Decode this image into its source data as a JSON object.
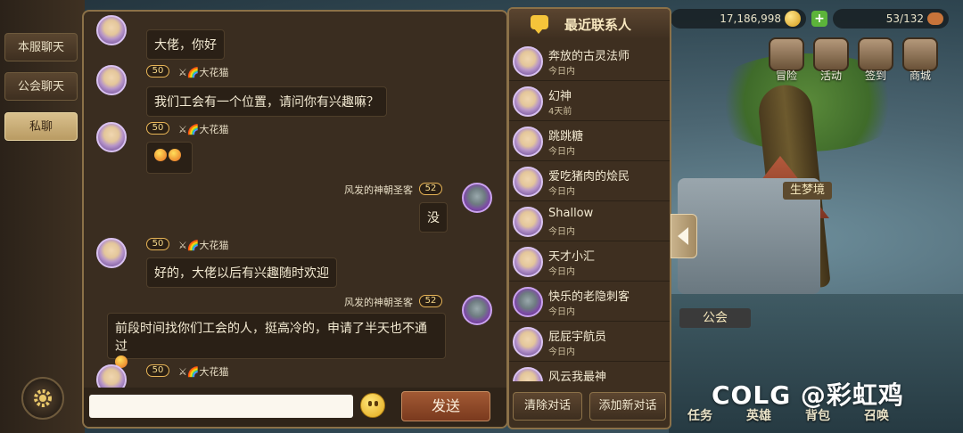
{
  "tabs": [
    {
      "label": "本服聊天",
      "active": false
    },
    {
      "label": "公会聊天",
      "active": false
    },
    {
      "label": "私聊",
      "active": true
    }
  ],
  "messages": [
    {
      "side": "left",
      "level": "",
      "name": "",
      "text": "大佬，你好"
    },
    {
      "side": "left",
      "level": "50",
      "name": "⚔🌈大花猫",
      "text": "我们工会有一个位置，请问你有兴趣嘛？"
    },
    {
      "side": "left",
      "level": "50",
      "name": "⚔🌈大花猫",
      "text": "",
      "emoji": true
    },
    {
      "side": "right",
      "level": "52",
      "name": "风发的神朝圣客",
      "text": "没"
    },
    {
      "side": "left",
      "level": "50",
      "name": "⚔🌈大花猫",
      "text": "好的，大佬以后有兴趣随时欢迎"
    },
    {
      "side": "right",
      "level": "52",
      "name": "风发的神朝圣客",
      "text": "前段时间找你们工会的人，挺高冷的，申请了半天也不通过"
    },
    {
      "side": "left",
      "level": "50",
      "name": "⚔🌈大花猫",
      "text": ""
    }
  ],
  "input": {
    "placeholder": "",
    "send_label": "发送"
  },
  "contacts": {
    "title": "最近联系人",
    "items": [
      {
        "name": "奔放的古灵法师",
        "time": "今日内"
      },
      {
        "name": "幻神",
        "time": "4天前"
      },
      {
        "name": "跳跳糖",
        "time": "今日内"
      },
      {
        "name": "爱吃猪肉的烩民",
        "time": "今日内"
      },
      {
        "name": "Shallow",
        "time": "今日内"
      },
      {
        "name": "天才小汇",
        "time": "今日内"
      },
      {
        "name": "快乐的老隐刺客",
        "time": "今日内"
      },
      {
        "name": "屁屁宇航员",
        "time": "今日内"
      },
      {
        "name": "风云我最神",
        "time": ""
      }
    ],
    "clear_label": "清除对话",
    "add_label": "添加新对话"
  },
  "game": {
    "gold": "17,186,998",
    "stamina": "53/132",
    "icons": [
      "冒险",
      "活动",
      "签到",
      "商城"
    ],
    "dream_banner": "生梦境",
    "guild_banner": "公会",
    "bottom_nav": [
      "任务",
      "英雄",
      "背包",
      "召唤"
    ]
  },
  "watermark": "COLG @彩虹鸡",
  "colors": {
    "panel": "#3a2d20",
    "border": "#8b7148",
    "accent": "#e7b456"
  }
}
